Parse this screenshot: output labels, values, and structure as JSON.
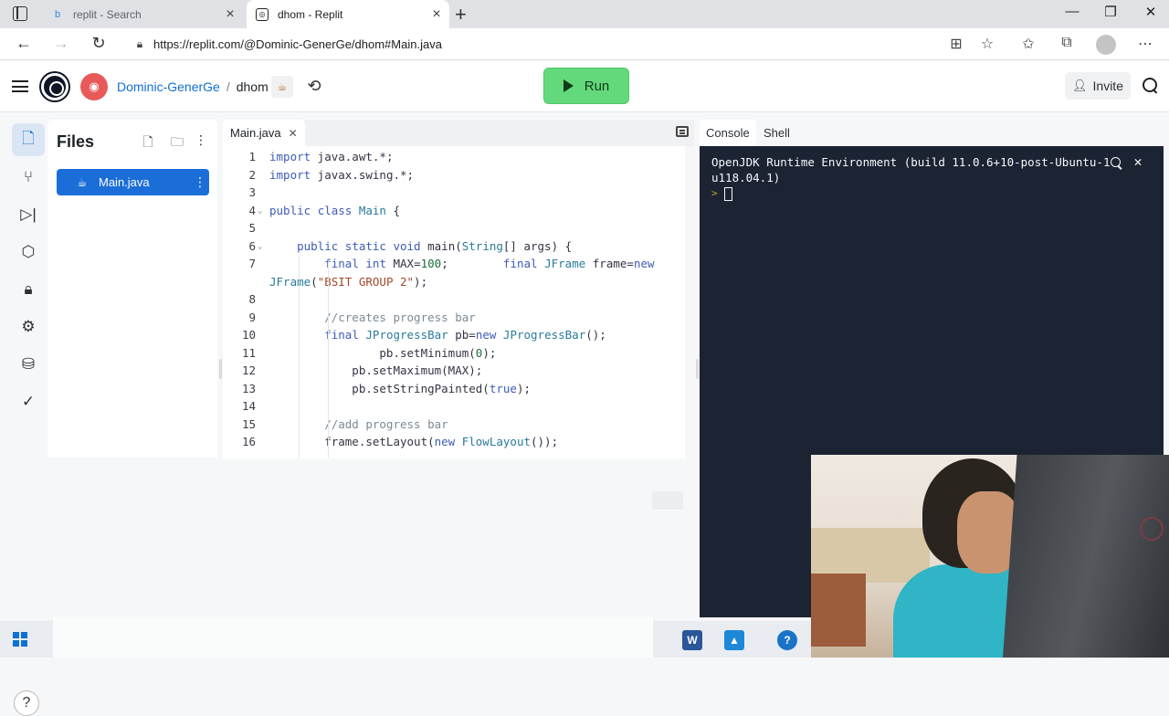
{
  "browser": {
    "tabs": [
      {
        "title": "replit - Search",
        "favicon": "bing-icon"
      },
      {
        "title": "dhom - Replit",
        "favicon": "replit-icon"
      }
    ],
    "url": "https://replit.com/@Dominic-GenerGe/dhom#Main.java",
    "window_controls": [
      "minimize",
      "maximize",
      "close"
    ]
  },
  "header": {
    "username": "Dominic-GenerGe",
    "separator": "/",
    "repl_name": "dhom",
    "run_label": "Run",
    "invite_label": "Invite",
    "run_color": "#64d97b"
  },
  "rail": {
    "items": [
      "files-icon",
      "git-icon",
      "debugger-icon",
      "packages-icon",
      "secrets-icon",
      "settings-icon",
      "database-icon",
      "checks-icon"
    ],
    "help_label": "?"
  },
  "files": {
    "title": "Files",
    "items": [
      {
        "name": "Main.java",
        "selected": true
      }
    ]
  },
  "editor": {
    "tab_label": "Main.java",
    "lines": [
      {
        "n": "1",
        "text": "import java.awt.*;"
      },
      {
        "n": "2",
        "text": "import javax.swing.*;"
      },
      {
        "n": "3",
        "text": ""
      },
      {
        "n": "4",
        "text": "public class Main {"
      },
      {
        "n": "5",
        "text": ""
      },
      {
        "n": "6",
        "text": "    public static void main(String[] args) {"
      },
      {
        "n": "7",
        "text": "        final int MAX=100;        final JFrame frame=new"
      },
      {
        "n": "",
        "text": "JFrame(\"BSIT GROUP 2\");"
      },
      {
        "n": "8",
        "text": ""
      },
      {
        "n": "9",
        "text": "        //creates progress bar"
      },
      {
        "n": "10",
        "text": "        final JProgressBar pb=new JProgressBar();"
      },
      {
        "n": "11",
        "text": "                pb.setMinimum(0);"
      },
      {
        "n": "12",
        "text": "            pb.setMaximum(MAX);"
      },
      {
        "n": "13",
        "text": "            pb.setStringPainted(true);"
      },
      {
        "n": "14",
        "text": ""
      },
      {
        "n": "15",
        "text": "        //add progress bar"
      },
      {
        "n": "16",
        "text": "        frame.setLayout(new FlowLayout());"
      }
    ]
  },
  "console": {
    "tabs": [
      "Console",
      "Shell"
    ],
    "output_line_1": "OpenJDK Runtime Environment (build 11.0.6+10-post-Ubuntu-1",
    "output_line_2": "u118.04.1)",
    "prompt": ">",
    "background": "#1c2333"
  }
}
